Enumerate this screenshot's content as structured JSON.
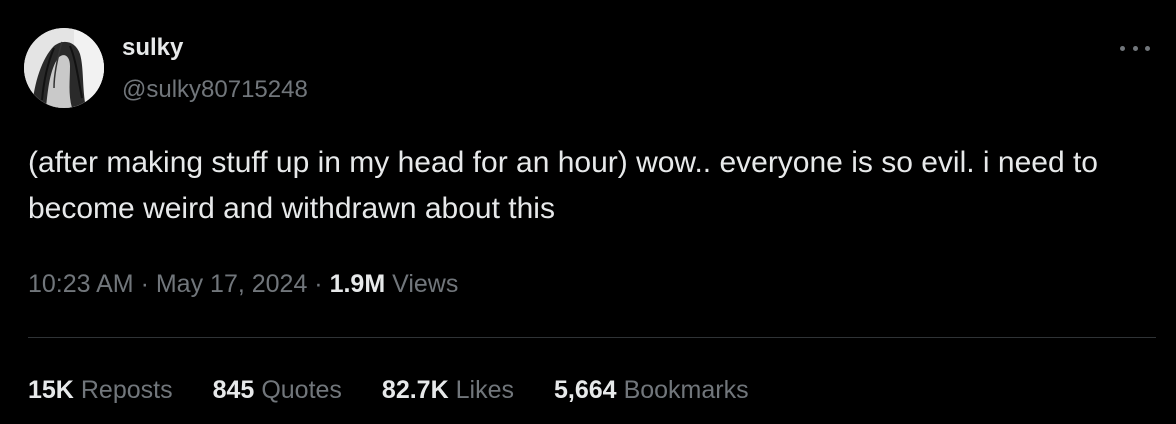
{
  "author": {
    "display_name": "sulky",
    "handle": "@sulky80715248"
  },
  "avatar": {
    "icon": "profile-photo-icon"
  },
  "post": {
    "text": "(after making stuff up in my head for an hour) wow.. everyone is so evil. i need to become weird and withdrawn about this"
  },
  "meta": {
    "time": "10:23 AM",
    "separator1": " · ",
    "date": "May 17, 2024",
    "separator2": " · ",
    "views_count": "1.9M",
    "views_label": " Views"
  },
  "stats": {
    "reposts_count": "15K",
    "reposts_label": "Reposts",
    "quotes_count": "845",
    "quotes_label": "Quotes",
    "likes_count": "82.7K",
    "likes_label": "Likes",
    "bookmarks_count": "5,664",
    "bookmarks_label": "Bookmarks"
  },
  "colors": {
    "background": "#000000",
    "primary_text": "#e7e9ea",
    "secondary_text": "#71767b",
    "divider": "#2f3336"
  }
}
